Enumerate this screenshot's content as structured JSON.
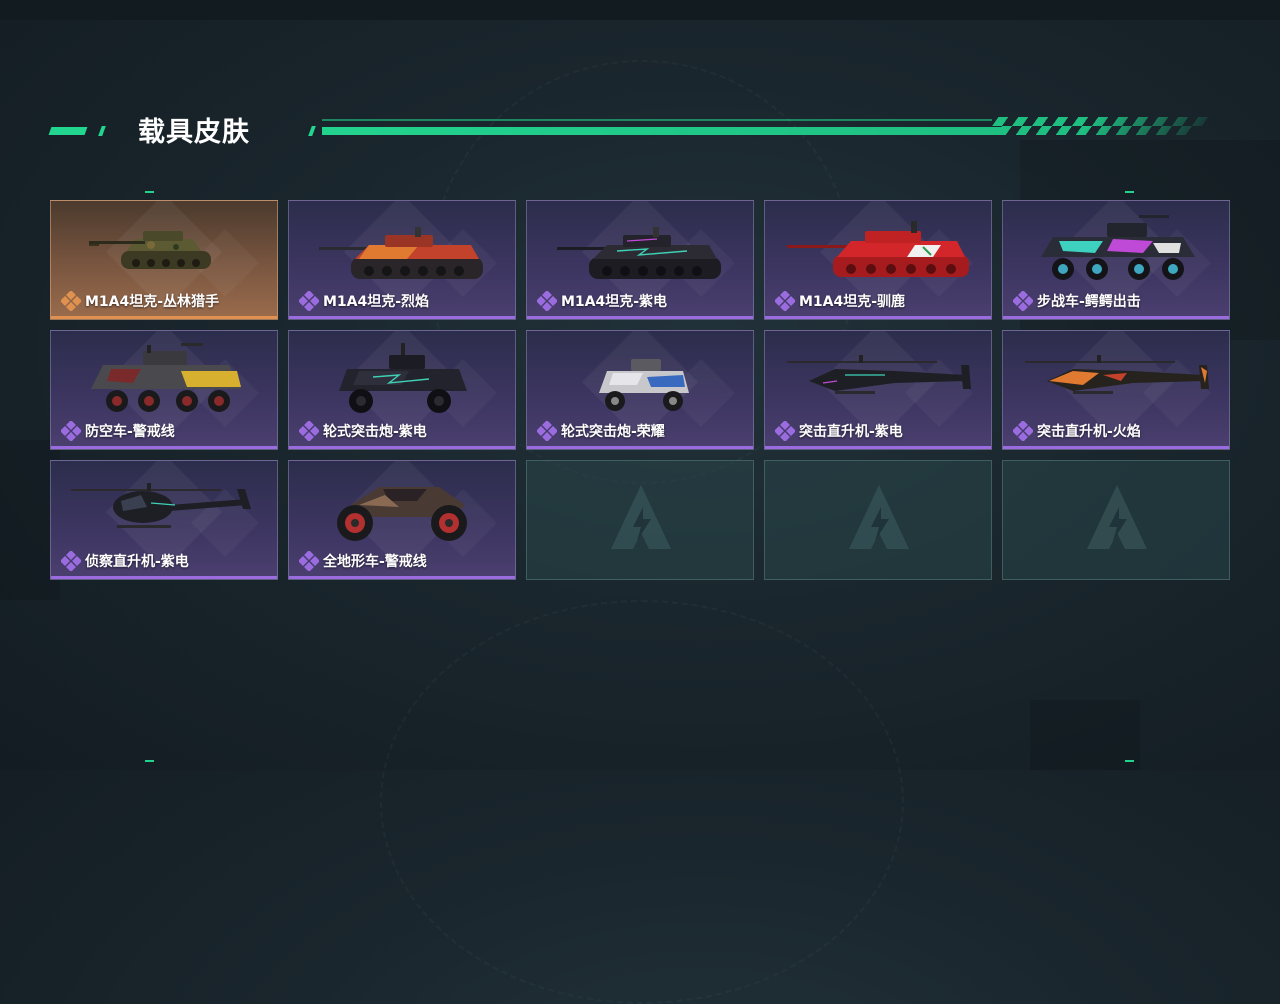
{
  "header": {
    "title": "载具皮肤"
  },
  "colors": {
    "accent": "#23d690",
    "purple_rarity": "#9a6ce0",
    "gold_rarity": "#e0904f"
  },
  "skins": [
    {
      "label": "M1A4坦克-丛林猎手",
      "rarity": "gold",
      "vehicle_icon": "tank-icon"
    },
    {
      "label": "M1A4坦克-烈焰",
      "rarity": "purple",
      "vehicle_icon": "tank-icon"
    },
    {
      "label": "M1A4坦克-紫电",
      "rarity": "purple",
      "vehicle_icon": "tank-icon"
    },
    {
      "label": "M1A4坦克-驯鹿",
      "rarity": "purple",
      "vehicle_icon": "tank-icon"
    },
    {
      "label": "步战车-鳄鳄出击",
      "rarity": "purple",
      "vehicle_icon": "ifv-icon"
    },
    {
      "label": "防空车-警戒线",
      "rarity": "purple",
      "vehicle_icon": "aa-vehicle-icon"
    },
    {
      "label": "轮式突击炮-紫电",
      "rarity": "purple",
      "vehicle_icon": "armored-car-icon"
    },
    {
      "label": "轮式突击炮-荣耀",
      "rarity": "purple",
      "vehicle_icon": "armored-car-icon"
    },
    {
      "label": "突击直升机-紫电",
      "rarity": "purple",
      "vehicle_icon": "attack-helicopter-icon"
    },
    {
      "label": "突击直升机-火焰",
      "rarity": "purple",
      "vehicle_icon": "attack-helicopter-icon"
    },
    {
      "label": "侦察直升机-紫电",
      "rarity": "purple",
      "vehicle_icon": "scout-helicopter-icon"
    },
    {
      "label": "全地形车-警戒线",
      "rarity": "purple",
      "vehicle_icon": "atv-icon"
    }
  ],
  "empty_slots": 3
}
